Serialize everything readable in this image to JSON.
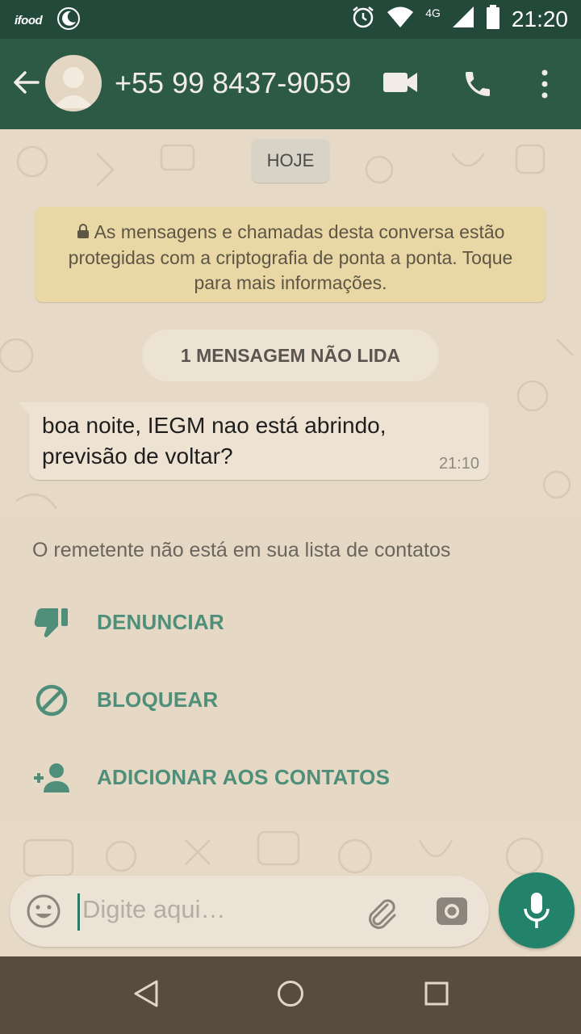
{
  "status_bar": {
    "notification_app": "ifood",
    "network": "4G",
    "time": "21:20",
    "icons": [
      "ifood-icon",
      "moon-icon",
      "alarm-icon",
      "wifi-icon",
      "signal-icon",
      "battery-icon"
    ]
  },
  "app_bar": {
    "contact": "+55 99 8437-9059",
    "icons": [
      "back-arrow-icon",
      "avatar-placeholder-icon",
      "video-call-icon",
      "phone-icon",
      "more-vert-icon"
    ],
    "color": "#2c5a45"
  },
  "chat": {
    "date_chip": "HOJE",
    "encryption_notice": "As mensagens e chamadas desta conversa estão protegidas com a criptografia de ponta a ponta. Toque para mais informações.",
    "unread_banner": "1 MENSAGEM NÃO LIDA",
    "messages": [
      {
        "text": "boa noite, IEGM nao está abrindo, previsão de voltar?",
        "time": "21:10",
        "direction": "incoming"
      }
    ]
  },
  "unknown_sender_panel": {
    "note": "O remetente não está em sua lista de contatos",
    "actions": [
      {
        "label": "DENUNCIAR",
        "icon": "thumb-down-icon"
      },
      {
        "label": "BLOQUEAR",
        "icon": "block-icon"
      },
      {
        "label": "ADICIONAR AOS CONTATOS",
        "icon": "add-person-icon"
      }
    ],
    "accent_color": "#4f8f79"
  },
  "composer": {
    "placeholder": "Digite aqui…",
    "icons": [
      "emoji-icon",
      "attach-icon",
      "camera-icon",
      "mic-icon"
    ],
    "mic_color": "#23836a"
  },
  "nav_bar": {
    "icons": [
      "back-triangle-icon",
      "home-circle-icon",
      "recents-square-icon"
    ]
  }
}
